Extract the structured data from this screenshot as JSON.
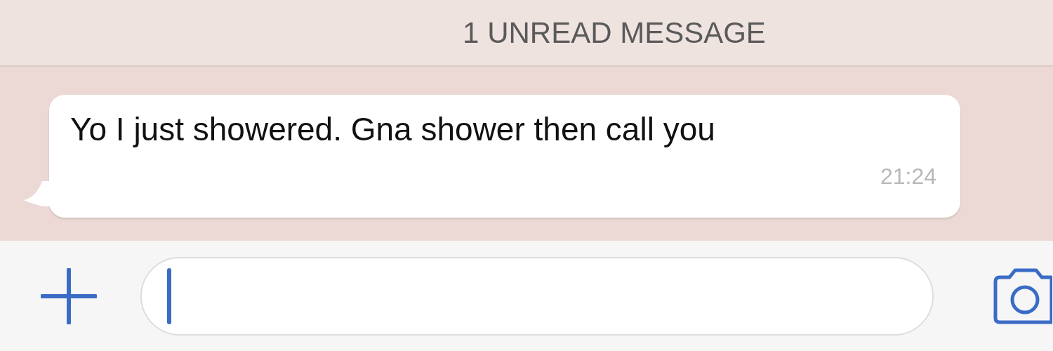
{
  "banner": {
    "text": "1 UNREAD MESSAGE"
  },
  "messages": [
    {
      "text": "Yo I just showered. Gna shower then call you",
      "time": "21:24"
    }
  ],
  "composer": {
    "focused": true
  }
}
